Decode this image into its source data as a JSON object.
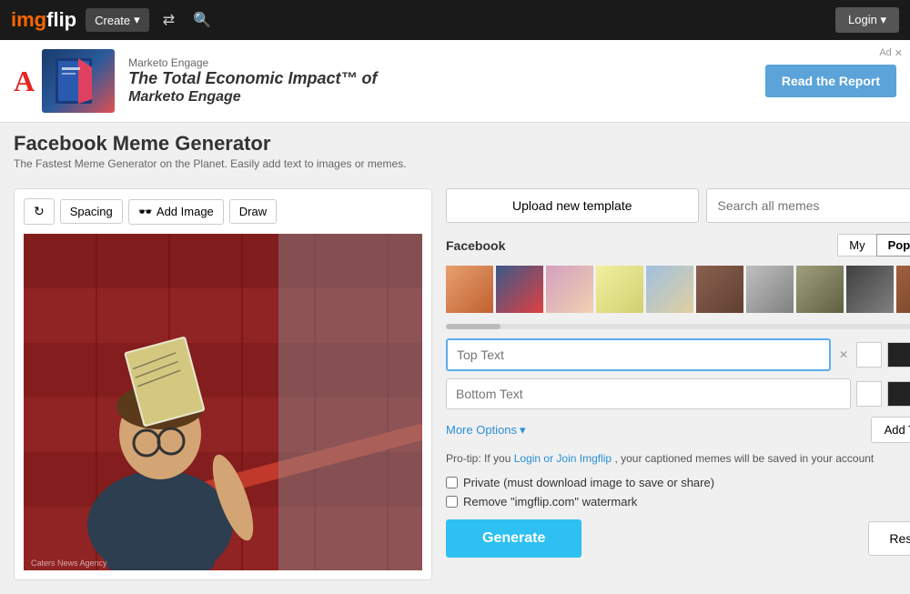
{
  "header": {
    "logo_img": "img",
    "logo_text": "flip",
    "create_label": "Create",
    "login_label": "Login"
  },
  "ad": {
    "brand_label": "Marketo Engage",
    "headline1": "The Total Economic Impact™ of",
    "headline2": "Marketo Engage",
    "cta_label": "Read the Report",
    "close_label": "×",
    "ad_label": "Ad"
  },
  "page": {
    "title": "Facebook Meme Generator",
    "subtitle": "The Fastest Meme Generator on the Planet. Easily add text to images or memes.",
    "image_credit": "Caters News Agency"
  },
  "toolbar": {
    "refresh_title": "refresh",
    "spacing_label": "Spacing",
    "add_image_label": "Add Image",
    "draw_label": "Draw"
  },
  "right": {
    "upload_label": "Upload new template",
    "search_placeholder": "Search all memes",
    "fb_title": "Facebook",
    "my_label": "My",
    "popular_label": "Popular"
  },
  "text_inputs": {
    "top_placeholder": "Top Text",
    "bottom_placeholder": "Bottom Text"
  },
  "options": {
    "more_options_label": "More Options",
    "add_text_label": "Add Text",
    "protip": "Pro-tip: If you ",
    "login_link": "Login or Join Imgflip",
    "protip2": ", your captioned memes will be saved in your account",
    "private_label": "Private",
    "private_note": "(must download image to save or share)",
    "watermark_label": "Remove \"imgflip.com\" watermark",
    "generate_label": "Generate",
    "reset_label": "Reset"
  }
}
